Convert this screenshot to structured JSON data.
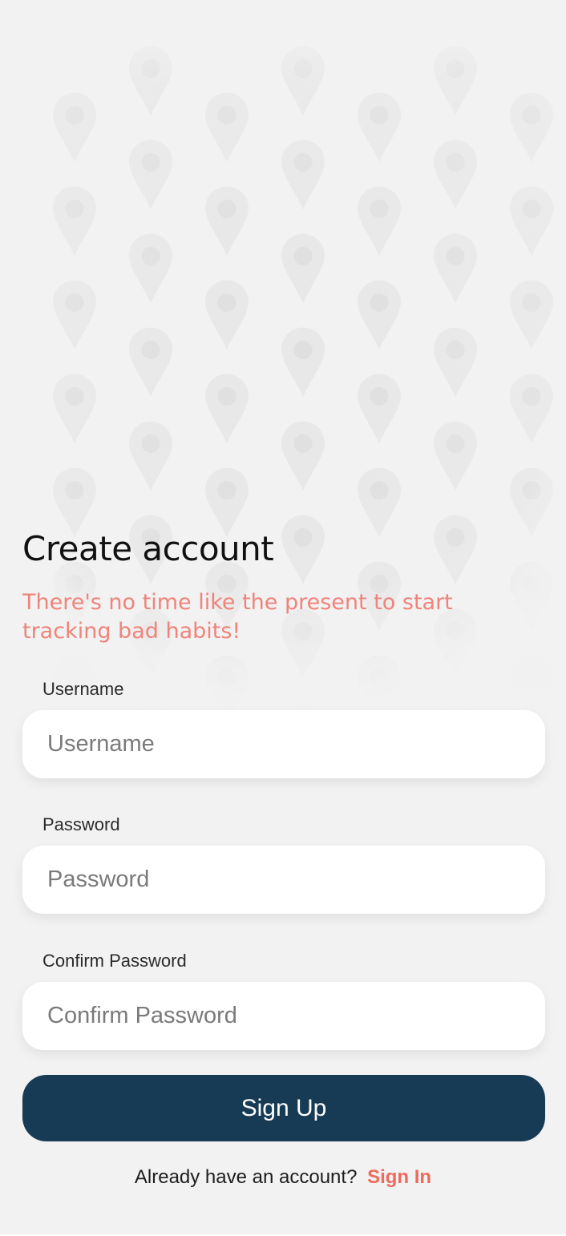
{
  "header": {
    "title": "Create account",
    "subtitle": "There's no time like the present to start tracking bad habits!"
  },
  "form": {
    "username": {
      "label": "Username",
      "placeholder": "Username",
      "value": ""
    },
    "password": {
      "label": "Password",
      "placeholder": "Password",
      "value": ""
    },
    "confirm_password": {
      "label": "Confirm Password",
      "placeholder": "Confirm Password",
      "value": ""
    }
  },
  "actions": {
    "signup_label": "Sign Up",
    "signin_prompt": "Already have an account?",
    "signin_label": "Sign In"
  },
  "theme": {
    "background": "#f2f2f2",
    "accent": "#ec6b5e",
    "subtitle_color": "#f0837a",
    "button": "#173a55",
    "pin_color": "#e6e6e6"
  },
  "icons": {
    "background_pattern": "map-pin-icon"
  }
}
